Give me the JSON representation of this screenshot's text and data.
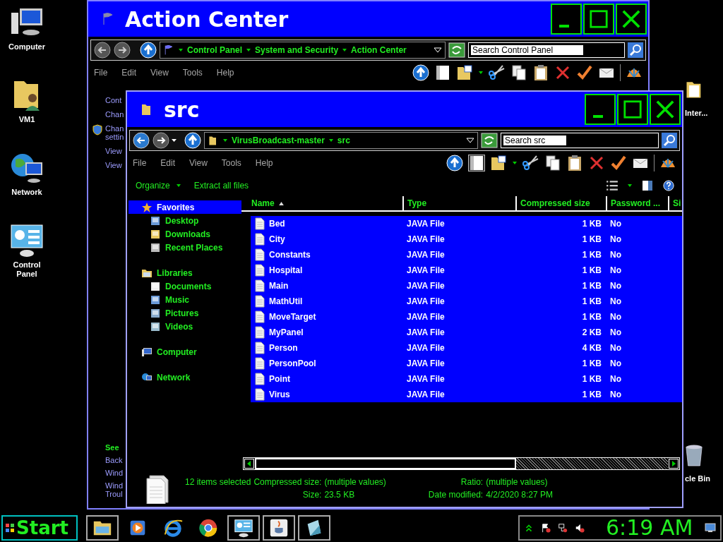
{
  "desktop_icons": [
    {
      "label": "Computer"
    },
    {
      "label": "VM1"
    },
    {
      "label": "Network"
    },
    {
      "label": "Control Panel"
    }
  ],
  "desktop_icons_right": [
    {
      "label": "Inter..."
    },
    {
      "label": "cle Bin"
    }
  ],
  "back_window": {
    "title": "Action Center",
    "breadcrumb": [
      "Control Panel",
      "System and Security",
      "Action Center"
    ],
    "search": {
      "placeholder": "Search Control Panel"
    },
    "menu": [
      "File",
      "Edit",
      "View",
      "Tools",
      "Help"
    ],
    "links_top": [
      {
        "text": "Cont",
        "kind": "link"
      },
      {
        "text": "Chan",
        "kind": "link"
      },
      {
        "text": "Chan settin",
        "kind": "shield_link"
      },
      {
        "text": "View",
        "kind": "link"
      },
      {
        "text": "View",
        "kind": "link"
      }
    ],
    "links_bottom": [
      {
        "text": "See",
        "kind": "heading"
      },
      {
        "text": "Back",
        "kind": "link"
      },
      {
        "text": "Wind",
        "kind": "link"
      },
      {
        "text": "Wind Troul",
        "kind": "link"
      }
    ]
  },
  "front_window": {
    "title": "src",
    "breadcrumb": [
      "VirusBroadcast-master",
      "src"
    ],
    "search": {
      "placeholder": "Search src"
    },
    "menu": [
      "File",
      "Edit",
      "View",
      "Tools",
      "Help"
    ],
    "preview_pane": true,
    "commands": [
      {
        "label": "Organize",
        "dropdown": true
      },
      {
        "label": "Extract all files",
        "dropdown": false
      }
    ],
    "nav": [
      {
        "label": "Favorites",
        "selected": true,
        "children": [
          {
            "label": "Desktop",
            "selected": false
          },
          {
            "label": "Downloads",
            "selected": false
          },
          {
            "label": "Recent Places",
            "selected": false
          }
        ]
      },
      {
        "label": "Libraries",
        "selected": false,
        "children": [
          {
            "label": "Documents",
            "selected": false
          },
          {
            "label": "Music",
            "selected": false
          },
          {
            "label": "Pictures",
            "selected": false
          },
          {
            "label": "Videos",
            "selected": false
          }
        ]
      },
      {
        "label": "Computer",
        "selected": false
      },
      {
        "label": "Network",
        "selected": false
      }
    ],
    "table": {
      "columns": [
        {
          "label": "Name",
          "sorted": true
        },
        {
          "label": "Type",
          "sorted": false
        },
        {
          "label": "Compressed size",
          "sorted": false
        },
        {
          "label": "Password ...",
          "sorted": false
        },
        {
          "label": "Si",
          "sorted": false
        }
      ],
      "rows": [
        {
          "name": "Bed",
          "type": "JAVA File",
          "size": "1 KB",
          "password": "No",
          "selected": true
        },
        {
          "name": "City",
          "type": "JAVA File",
          "size": "1 KB",
          "password": "No",
          "selected": true
        },
        {
          "name": "Constants",
          "type": "JAVA File",
          "size": "1 KB",
          "password": "No",
          "selected": true
        },
        {
          "name": "Hospital",
          "type": "JAVA File",
          "size": "1 KB",
          "password": "No",
          "selected": true
        },
        {
          "name": "Main",
          "type": "JAVA File",
          "size": "1 KB",
          "password": "No",
          "selected": true
        },
        {
          "name": "MathUtil",
          "type": "JAVA File",
          "size": "1 KB",
          "password": "No",
          "selected": true
        },
        {
          "name": "MoveTarget",
          "type": "JAVA File",
          "size": "1 KB",
          "password": "No",
          "selected": true
        },
        {
          "name": "MyPanel",
          "type": "JAVA File",
          "size": "2 KB",
          "password": "No",
          "selected": true
        },
        {
          "name": "Person",
          "type": "JAVA File",
          "size": "4 KB",
          "password": "No",
          "selected": true
        },
        {
          "name": "PersonPool",
          "type": "JAVA File",
          "size": "1 KB",
          "password": "No",
          "selected": true
        },
        {
          "name": "Point",
          "type": "JAVA File",
          "size": "1 KB",
          "password": "No",
          "selected": true
        },
        {
          "name": "Virus",
          "type": "JAVA File",
          "size": "1 KB",
          "password": "No",
          "selected": true
        }
      ]
    },
    "status": {
      "count": "12 items selected",
      "fields_left": [
        {
          "label": "Compressed size:",
          "value": "(multiple values)"
        },
        {
          "label": "Size:",
          "value": "23.5 KB"
        }
      ],
      "fields_right": [
        {
          "label": "Ratio:",
          "value": "(multiple values)"
        },
        {
          "label": "Date modified:",
          "value": "4/2/2020 8:27 PM"
        }
      ]
    }
  },
  "taskbar": {
    "start": "Start",
    "buttons": [
      {
        "open": true
      },
      {
        "open": false
      },
      {
        "open": false
      },
      {
        "open": false
      },
      {
        "open": true
      },
      {
        "open": true
      },
      {
        "open": true
      }
    ],
    "clock": "6:19 AM"
  }
}
